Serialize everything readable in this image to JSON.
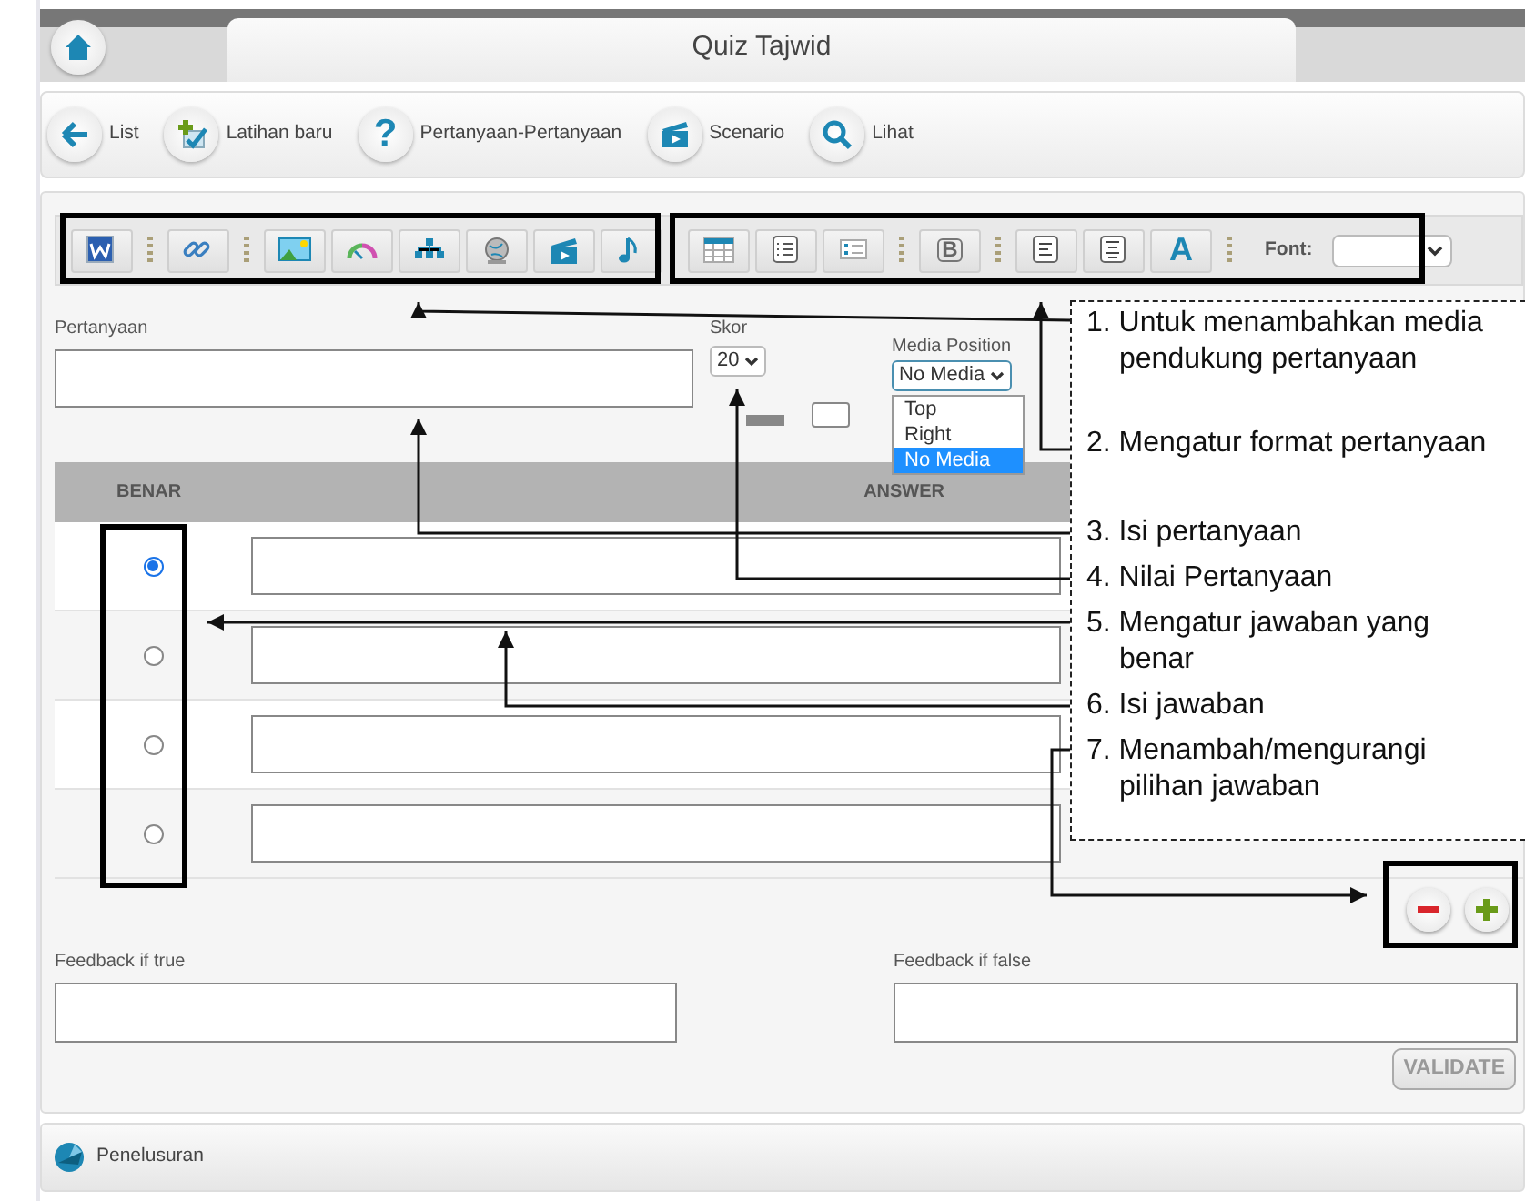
{
  "header": {
    "title": "Quiz Tajwid"
  },
  "nav": [
    {
      "kind": "back",
      "label": "List"
    },
    {
      "kind": "add",
      "label": "Latihan baru"
    },
    {
      "kind": "question",
      "glyph": "?",
      "label": "Pertanyaan-Pertanyaan"
    },
    {
      "kind": "scenario",
      "label": "Scenario"
    },
    {
      "kind": "view",
      "label": "Lihat"
    }
  ],
  "toolbar_media": [
    [
      {
        "kind": "word"
      }
    ],
    [
      {
        "kind": "link"
      }
    ],
    [
      {
        "kind": "image"
      },
      {
        "kind": "gauge"
      },
      {
        "kind": "chart"
      },
      {
        "kind": "globe"
      },
      {
        "kind": "video"
      },
      {
        "kind": "audio"
      }
    ]
  ],
  "toolbar_format": {
    "groups": [
      [
        {
          "kind": "table"
        },
        {
          "kind": "list"
        },
        {
          "kind": "form"
        }
      ],
      [
        {
          "kind": "bold",
          "glyph": "B"
        }
      ],
      [
        {
          "kind": "align-left"
        },
        {
          "kind": "align-center"
        },
        {
          "kind": "font-color",
          "glyph": "A"
        }
      ]
    ],
    "font_label": "Font:"
  },
  "question": {
    "label": "Pertanyaan"
  },
  "score": {
    "label": "Skor",
    "value": "20"
  },
  "media_position": {
    "label": "Media Position",
    "value": "No Media",
    "expanded": true,
    "options": [
      {
        "label": "Top",
        "selected": false
      },
      {
        "label": "Right",
        "selected": false
      },
      {
        "label": "No Media",
        "selected": true
      }
    ]
  },
  "answer_table": {
    "columns": [
      "BENAR",
      "ANSWER"
    ],
    "rows": [
      {
        "selected": true
      },
      {
        "selected": false
      },
      {
        "selected": false
      },
      {
        "selected": false
      }
    ]
  },
  "feedback_true": {
    "label": "Feedback if true"
  },
  "feedback_false": {
    "label": "Feedback if false"
  },
  "validate": {
    "label": "VALIDATE",
    "disabled": true
  },
  "footer": {
    "label": "Penelusuran"
  },
  "annotations": [
    "1. Untuk menambahkan media pendukung pertanyaan",
    "2. Mengatur format pertanyaan",
    "3. Isi pertanyaan",
    "4. Nilai Pertanyaan",
    "5. Mengatur jawaban yang benar",
    "6. Isi jawaban",
    "7. Menambah/mengurangi pilihan jawaban"
  ]
}
